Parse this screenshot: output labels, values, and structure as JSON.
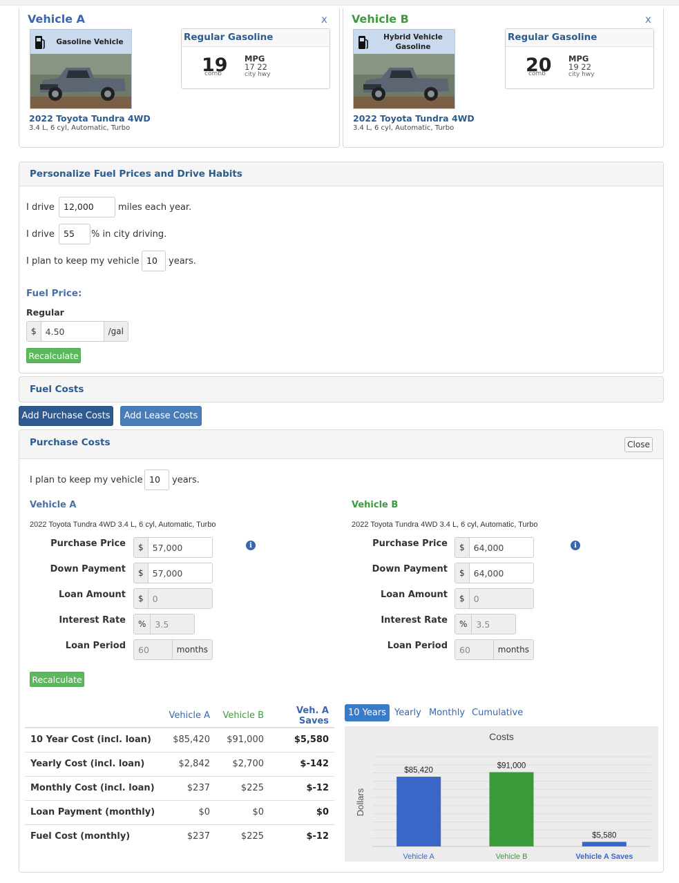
{
  "vehicles": [
    {
      "title": "Vehicle A",
      "close": "x",
      "photo_label": "Gasoline Vehicle",
      "fuel_type": "Regular Gasoline",
      "mpg_comb": "19",
      "mpg_comb_label": "comb",
      "mpg_label": "MPG",
      "mpg_city_hwy": "17 22",
      "city_hwy_label": "city hwy",
      "name": "2022 Toyota Tundra 4WD",
      "spec": "3.4 L, 6 cyl, Automatic, Turbo"
    },
    {
      "title": "Vehicle B",
      "close": "x",
      "photo_label_line1": "Hybrid Vehicle",
      "photo_label_line2": "Gasoline",
      "fuel_type": "Regular Gasoline",
      "mpg_comb": "20",
      "mpg_comb_label": "comb",
      "mpg_label": "MPG",
      "mpg_city_hwy": "19 22",
      "city_hwy_label": "city hwy",
      "name": "2022 Toyota Tundra 4WD",
      "spec": "3.4 L, 6 cyl, Automatic, Turbo"
    }
  ],
  "personalize": {
    "title": "Personalize Fuel Prices and Drive Habits",
    "drive_prefix": "I drive",
    "miles_value": "12,000",
    "miles_suffix": "miles each year.",
    "city_prefix": "I drive",
    "city_value": "55",
    "city_suffix": "% in city driving.",
    "keep_prefix": "I plan to keep my vehicle",
    "keep_value": "10",
    "keep_suffix": "years.",
    "fuel_price_heading": "Fuel Price:",
    "regular_label": "Regular",
    "currency": "$",
    "price_value": "4.50",
    "price_unit": "/gal",
    "recalculate": "Recalculate"
  },
  "fuel_costs": {
    "title": "Fuel Costs"
  },
  "buttons": {
    "add_purchase": "Add Purchase Costs",
    "add_lease": "Add Lease Costs"
  },
  "purchase": {
    "title": "Purchase Costs",
    "close": "Close",
    "keep_prefix": "I plan to keep my vehicle",
    "keep_value": "10",
    "keep_suffix": "years.",
    "recalculate": "Recalculate",
    "labels": {
      "purchase_price": "Purchase Price",
      "down_payment": "Down Payment",
      "loan_amount": "Loan Amount",
      "interest_rate": "Interest Rate",
      "loan_period": "Loan Period"
    },
    "currency": "$",
    "percent": "%",
    "months": "months",
    "info": "i",
    "vehicle_a": {
      "title": "Vehicle A",
      "desc": "2022 Toyota Tundra 4WD 3.4 L, 6 cyl, Automatic, Turbo",
      "purchase_price": "57,000",
      "down_payment": "57,000",
      "loan_amount": "0",
      "interest_rate": "3.5",
      "loan_period": "60"
    },
    "vehicle_b": {
      "title": "Vehicle B",
      "desc": "2022 Toyota Tundra 4WD 3.4 L, 6 cyl, Automatic, Turbo",
      "purchase_price": "64,000",
      "down_payment": "64,000",
      "loan_amount": "0",
      "interest_rate": "3.5",
      "loan_period": "60"
    }
  },
  "cost_table": {
    "headers": [
      "",
      "Vehicle A",
      "Vehicle B",
      "Veh. A Saves"
    ],
    "rows": [
      [
        "10 Year Cost (incl. loan)",
        "$85,420",
        "$91,000",
        "$5,580"
      ],
      [
        "Yearly Cost (incl. loan)",
        "$2,842",
        "$2,700",
        "$-142"
      ],
      [
        "Monthly Cost (incl. loan)",
        "$237",
        "$225",
        "$-12"
      ],
      [
        "Loan Payment (monthly)",
        "$0",
        "$0",
        "$0"
      ],
      [
        "Fuel Cost (monthly)",
        "$237",
        "$225",
        "$-12"
      ]
    ]
  },
  "tabs": [
    "10 Years",
    "Yearly",
    "Monthly",
    "Cumulative"
  ],
  "colors": {
    "vehicle_a": "#3a66c8",
    "vehicle_b": "#3a9a3a",
    "saves": "#3a66c8"
  },
  "chart_data": {
    "type": "bar",
    "title": "Costs",
    "ylabel": "Dollars",
    "categories": [
      "Vehicle A",
      "Vehicle B",
      "Vehicle A Saves"
    ],
    "values": [
      85420,
      91000,
      5580
    ],
    "value_labels": [
      "$85,420",
      "$91,000",
      "$5,580"
    ],
    "ylim": [
      0,
      110000
    ],
    "grid": true,
    "legend": "none"
  }
}
